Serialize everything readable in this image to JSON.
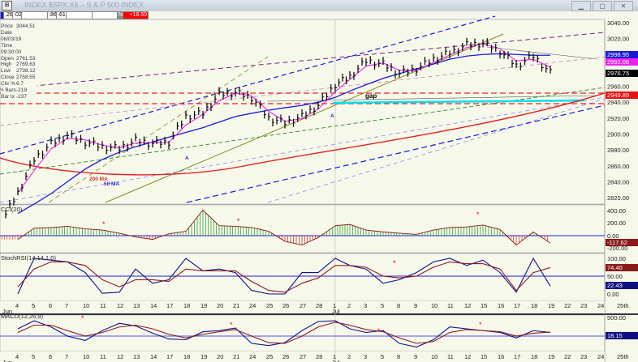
{
  "window": {
    "title": "INDEX $SPX.X6 – S & P 500 INDEX",
    "buttons": [
      "minimize",
      "restore",
      "close"
    ]
  },
  "toolbar": {
    "fields": [
      ".26",
      ".02",
      ".86",
      ".61"
    ],
    "mode": "N",
    "change": "+18.50"
  },
  "info": [
    {
      "k": "Price",
      "v": "3044.51"
    },
    {
      "k": "Date",
      "v": "06/03/19"
    },
    {
      "k": "Time",
      "v": "09:30:00"
    },
    {
      "k": "Open",
      "v": "2761.53"
    },
    {
      "k": "High",
      "v": "2769.63"
    },
    {
      "k": "Low",
      "v": "2738.12"
    },
    {
      "k": "Close",
      "v": "2758.55"
    },
    {
      "k": "Chr %",
      "v": "6.7"
    },
    {
      "k": "# Bars",
      "v": "-219"
    },
    {
      "k": "Bar Ix",
      "v": "-237"
    }
  ],
  "colors": {
    "bg": "#f6f8ea",
    "ma200": "#e02020",
    "ma50": "#1a1ad8",
    "ma5": "#ee22ee",
    "up": "#1a9a1a",
    "down": "#e02020"
  },
  "chart_data": [
    {
      "type": "line",
      "title": "S & P 500 INDEX",
      "ylim": [
        2810,
        3050
      ],
      "yticks": [
        3040,
        3020,
        3000,
        2980,
        2960,
        2940,
        2920,
        2900,
        2880,
        2860,
        2840,
        2820
      ],
      "yticklabels": [
        "3040.00",
        "3020.00",
        "",
        "",
        "2960.00",
        "2940.00",
        "2920.00",
        "2900.00",
        "2880.00",
        "2860.00",
        "2840.00",
        "2820.00"
      ],
      "dates": [
        "4",
        "5",
        "6",
        "7",
        "10",
        "11",
        "12",
        "13",
        "14",
        "17",
        "18",
        "19",
        "20",
        "21",
        "24",
        "25",
        "26",
        "27",
        "28",
        "1",
        "2",
        "3",
        "5",
        "8",
        "9",
        "10",
        "11",
        "12",
        "15",
        "16",
        "17",
        "18",
        "19"
      ],
      "close": [
        2826,
        2868,
        2888,
        2898,
        2890,
        2884,
        2882,
        2892,
        2888,
        2890,
        2922,
        2926,
        2950,
        2952,
        2946,
        2920,
        2914,
        2922,
        2936,
        2962,
        2972,
        2992,
        2988,
        2976,
        2982,
        2994,
        3002,
        3012,
        3014,
        3004,
        2986,
        2998,
        2977
      ],
      "ma200": [
        2872,
        2866,
        2862,
        2860,
        2858,
        2857,
        2857,
        2858,
        2859,
        2861,
        2863,
        2866,
        2869,
        2872,
        2875,
        2878,
        2881,
        2884,
        2887,
        2891,
        2895,
        2900,
        2905,
        2910,
        2915,
        2920,
        2926,
        2932,
        2938,
        2943,
        2947,
        2950,
        2950
      ],
      "ma50": [
        2800,
        2812,
        2825,
        2840,
        2856,
        2868,
        2877,
        2884,
        2890,
        2896,
        2902,
        2908,
        2915,
        2922,
        2926,
        2930,
        2933,
        2936,
        2940,
        2946,
        2954,
        2962,
        2970,
        2976,
        2982,
        2988,
        2994,
        2998,
        3000,
        3001,
        3000,
        2999,
        2999
      ],
      "annotations": [
        "200 MA",
        "50 MA",
        "gap",
        "A",
        "A",
        "A"
      ],
      "value_labels": [
        {
          "text": "2998.95",
          "color": "#1a1ad8"
        },
        {
          "text": "2992.08",
          "color": "#ee22ee"
        },
        {
          "text": "2976.75",
          "color": "#000000"
        },
        {
          "text": "2949.89",
          "color": "#ee1111"
        }
      ],
      "xlabels": [
        "4",
        "5",
        "6",
        "7",
        "10",
        "11",
        "12",
        "13",
        "14",
        "17",
        "18",
        "19",
        "20",
        "21",
        "24",
        "25",
        "26",
        "27",
        "28",
        "1",
        "2",
        "3",
        "5",
        "8",
        "9",
        "10",
        "11",
        "12",
        "15",
        "16",
        "17",
        "18",
        "19",
        "22",
        "23",
        "24",
        "25th"
      ],
      "month_labels": [
        "Jun",
        "Jul"
      ]
    },
    {
      "type": "bar",
      "title": "CCI(20)",
      "ylim": [
        -300,
        450
      ],
      "yticklabels": [
        "400.00",
        "200.00",
        "0.00",
        "-200.00"
      ],
      "values": [
        -60,
        120,
        130,
        150,
        110,
        90,
        40,
        -20,
        -60,
        30,
        70,
        410,
        160,
        150,
        130,
        70,
        -90,
        -150,
        -30,
        160,
        180,
        90,
        60,
        40,
        20,
        90,
        130,
        140,
        170,
        100,
        -150,
        60,
        -118
      ],
      "last": "-117.62"
    },
    {
      "type": "line",
      "title": "StochRSI(14,14,1,0)",
      "ylim": [
        0,
        100
      ],
      "yticklabels": [
        "100.00",
        "50.00",
        "0.00"
      ],
      "k": [
        0,
        100,
        95,
        90,
        60,
        2,
        5,
        70,
        30,
        40,
        100,
        65,
        70,
        60,
        10,
        0,
        0,
        60,
        60,
        100,
        80,
        70,
        30,
        40,
        60,
        90,
        100,
        80,
        95,
        60,
        5,
        100,
        22
      ],
      "d": [
        20,
        70,
        90,
        90,
        80,
        40,
        20,
        40,
        40,
        35,
        70,
        65,
        65,
        65,
        35,
        10,
        5,
        30,
        45,
        80,
        80,
        75,
        50,
        45,
        50,
        75,
        90,
        85,
        85,
        70,
        10,
        60,
        74
      ],
      "last_k": "22.43",
      "last_d": "74.40"
    },
    {
      "type": "line",
      "title": "MACD(12,26,9)",
      "yticklabels": [
        "500.00"
      ],
      "macd": [
        200,
        420,
        250,
        0,
        -120,
        150,
        350,
        280,
        80,
        -80,
        -100,
        120,
        150,
        220,
        -200,
        -260,
        -180,
        150,
        400,
        420,
        200,
        100,
        150,
        -200,
        -300,
        -100,
        250,
        200,
        150,
        100,
        -50,
        150,
        100
      ],
      "signal": [
        100,
        300,
        300,
        150,
        0,
        100,
        250,
        300,
        200,
        50,
        -50,
        50,
        120,
        180,
        0,
        -180,
        -200,
        0,
        250,
        380,
        300,
        180,
        120,
        -50,
        -200,
        -150,
        100,
        180,
        150,
        120,
        0,
        80,
        110
      ],
      "last": "18.15"
    }
  ]
}
